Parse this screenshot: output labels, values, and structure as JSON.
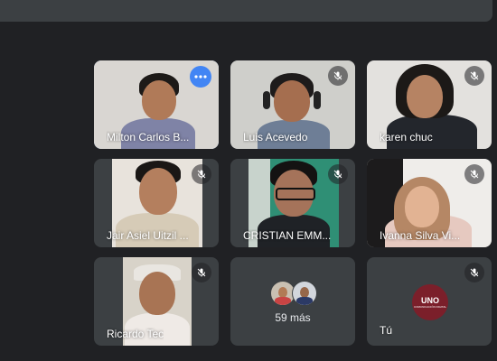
{
  "participants": [
    {
      "name": "Milton Carlos B...",
      "indicator": "more-options"
    },
    {
      "name": "Luis Acevedo",
      "indicator": "muted"
    },
    {
      "name": "karen chuc",
      "indicator": "muted"
    },
    {
      "name": "Jair Asiel Uitzil ...",
      "indicator": "muted"
    },
    {
      "name": "CRISTIAN EMM...",
      "indicator": "muted"
    },
    {
      "name": "Ivanna Silva Vi...",
      "indicator": "muted"
    },
    {
      "name": "Ricardo Tec",
      "indicator": "muted"
    }
  ],
  "overflow_tile": {
    "count_label": "59 más"
  },
  "self_tile": {
    "name": "Tú",
    "logo_text": "UNO",
    "logo_subtext": "COMUNICACIÓN DIGITAL"
  },
  "colors": {
    "background": "#202124",
    "tile": "#3c4043",
    "active_border": "#8ab4f8",
    "more_button": "#4285f4"
  }
}
